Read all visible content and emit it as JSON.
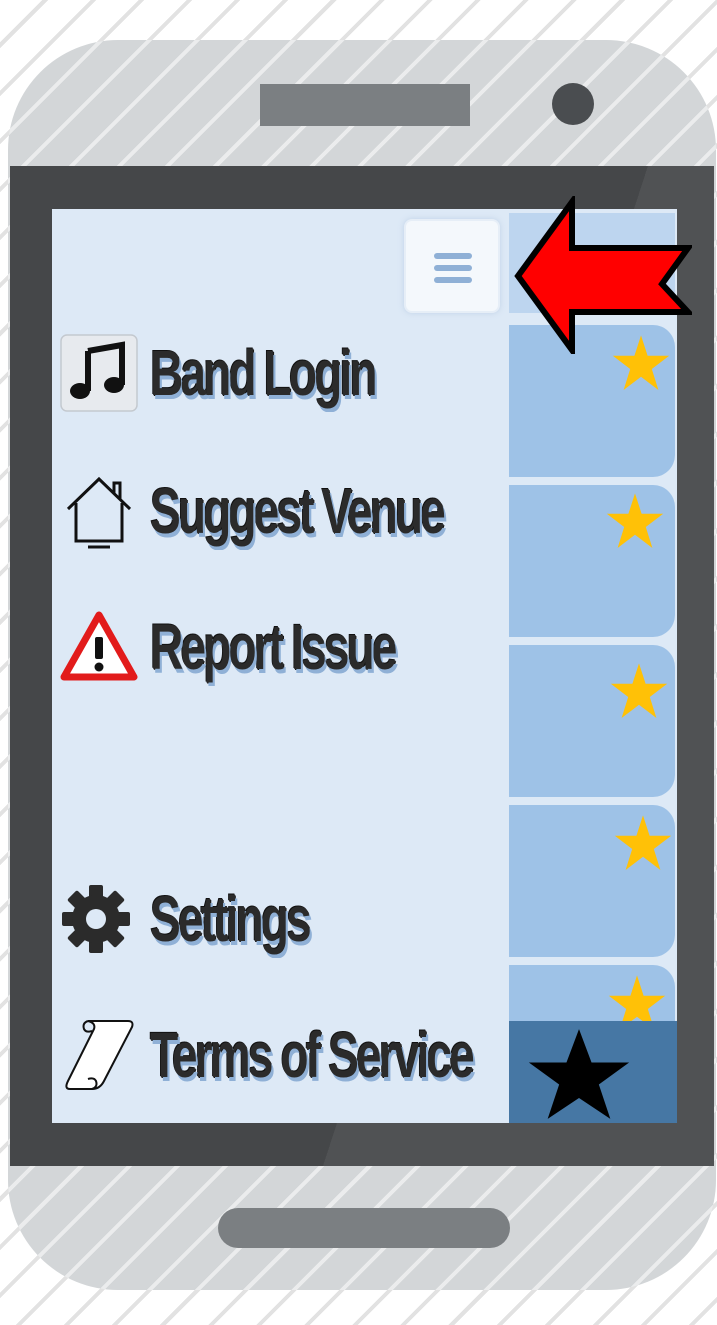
{
  "menu": {
    "items": [
      {
        "label": "Band Login",
        "icon": "music-note-icon"
      },
      {
        "label": "Suggest Venue",
        "icon": "house-icon"
      },
      {
        "label": "Report Issue",
        "icon": "warning-icon"
      },
      {
        "label": "Settings",
        "icon": "gear-icon"
      },
      {
        "label": "Terms of Service",
        "icon": "scroll-icon"
      }
    ],
    "toggle_icon": "hamburger-icon"
  },
  "side_list": {
    "card_icon": "star-icon",
    "star_color": "#ffc107",
    "bottom_icon": "star-icon",
    "bottom_color": "#000000"
  },
  "annotation": {
    "pointer_icon": "red-arrow-icon",
    "color": "#ff0000"
  }
}
